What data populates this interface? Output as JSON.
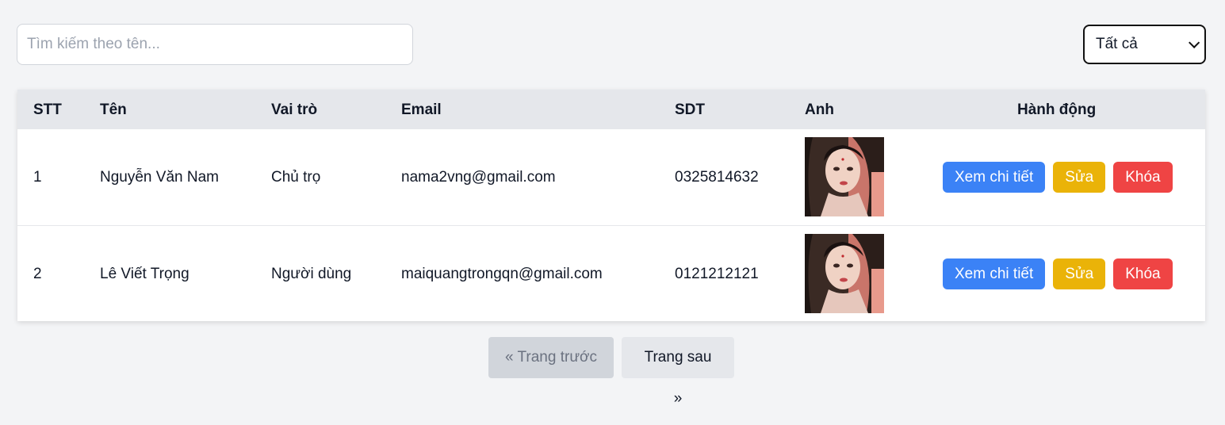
{
  "search": {
    "placeholder": "Tìm kiếm theo tên..."
  },
  "filter": {
    "selected": "Tất cả"
  },
  "table": {
    "headers": [
      "STT",
      "Tên",
      "Vai trò",
      "Email",
      "SDT",
      "Anh",
      "Hành động"
    ],
    "rows": [
      {
        "stt": "1",
        "name": "Nguyễn Văn Nam",
        "role": "Chủ trọ",
        "email": "nama2vng@gmail.com",
        "phone": "0325814632"
      },
      {
        "stt": "2",
        "name": "Lê Viết Trọng",
        "role": "Người dùng",
        "email": "maiquangtrongqn@gmail.com",
        "phone": "0121212121"
      }
    ],
    "actions": {
      "view": "Xem chi tiết",
      "edit": "Sửa",
      "lock": "Khóa"
    }
  },
  "pagination": {
    "prev": "« Trang trước",
    "next": "Trang sau »"
  }
}
